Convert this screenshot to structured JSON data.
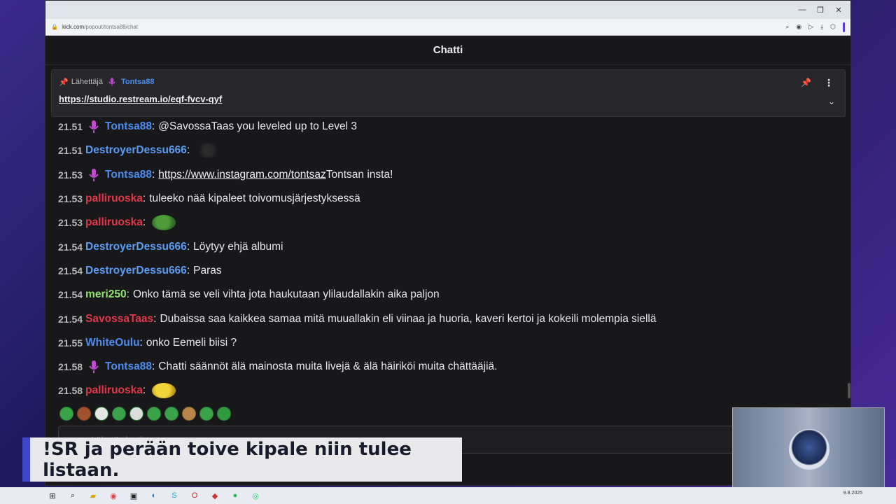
{
  "browser": {
    "url_host": "kick.com",
    "url_path": "/popout/tontsa88/chat",
    "window_controls": [
      "—",
      "❐",
      "✕"
    ]
  },
  "chat": {
    "title": "Chatti",
    "pinned": {
      "label": "Lähettäjä",
      "user": "Tontsa88",
      "link": "https://studio.restream.io/eqf-fvcv-qyf"
    },
    "messages": [
      {
        "time": "21.51",
        "mod": true,
        "user": "Tontsa88",
        "color": "#4a8cf0",
        "text": "@SavossaTaas you leveled up to Level 3"
      },
      {
        "time": "21.51",
        "mod": false,
        "user": "DestroyerDessu666",
        "color": "#5b9cf2",
        "text": "",
        "emote": "dark"
      },
      {
        "time": "21.53",
        "mod": true,
        "user": "Tontsa88",
        "color": "#4a8cf0",
        "link": "https://www.instagram.com/tontsaz",
        "text": " Tontsan insta!"
      },
      {
        "time": "21.53",
        "mod": false,
        "user": "palliruoska",
        "color": "#e2364a",
        "text": "tuleeko nää kipaleet toivomusjärjestyksessä"
      },
      {
        "time": "21.53",
        "mod": false,
        "user": "palliruoska",
        "color": "#e2364a",
        "text": "",
        "emote": "pepe"
      },
      {
        "time": "21.54",
        "mod": false,
        "user": "DestroyerDessu666",
        "color": "#5b9cf2",
        "text": "Löytyy ehjä albumi"
      },
      {
        "time": "21.54",
        "mod": false,
        "user": "DestroyerDessu666",
        "color": "#5b9cf2",
        "text": "Paras"
      },
      {
        "time": "21.54",
        "mod": false,
        "user": "meri250",
        "color": "#8fe36b",
        "text": "Onko tämä se veli vihta jota haukutaan ylilaudallakin aika paljon"
      },
      {
        "time": "21.54",
        "mod": false,
        "user": "SavossaTaas",
        "color": "#e2364a",
        "text": "Dubaissa saa kaikkea samaa mitä muuallakin eli viinaa ja huoria, kaveri kertoi ja kokeili molempia siellä"
      },
      {
        "time": "21.55",
        "mod": false,
        "user": "WhiteOulu",
        "color": "#4a8cf0",
        "text": "onko Eemeli biisi ?"
      },
      {
        "time": "21.58",
        "mod": true,
        "user": "Tontsa88",
        "color": "#4a8cf0",
        "text": "Chatti säännöt älä mainosta muita livejä & älä häiriköi muita chättääjiä."
      },
      {
        "time": "21.58",
        "mod": false,
        "user": "palliruoska",
        "color": "#e2364a",
        "text": "",
        "emote": "yellow"
      }
    ],
    "input_placeholder": "Lähetä viesti"
  },
  "overlay": {
    "banner_text": "!SR ja perään toive kipale niin tulee listaan."
  },
  "taskbar": {
    "date": "9.8.2025"
  },
  "colors": {
    "accent": "#3f47c8",
    "mod_icon": "#c04ad0"
  }
}
